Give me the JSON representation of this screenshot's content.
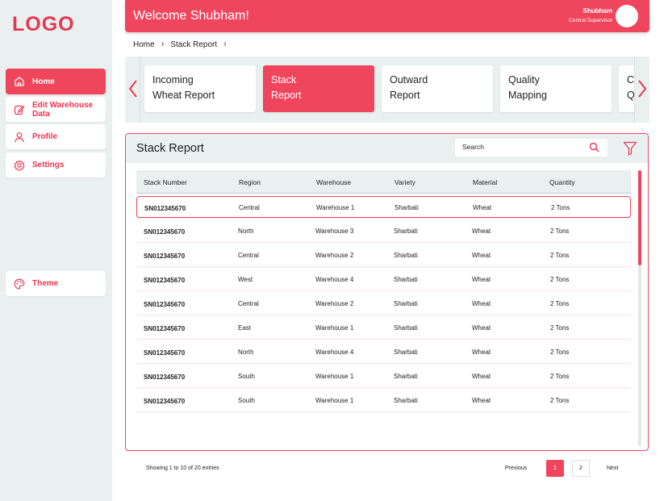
{
  "colors": {
    "accent": "#f0465d",
    "sidebar_bg": "#e9f0ef",
    "white": "#ffffff"
  },
  "logo": "LOGO",
  "sidebar": {
    "items": [
      {
        "label": "Home",
        "icon": "home-icon",
        "active": true
      },
      {
        "label": "Edit Warehouse Data",
        "icon": "edit-icon",
        "active": false
      },
      {
        "label": "Profile",
        "icon": "user-icon",
        "active": false
      },
      {
        "label": "Settings",
        "icon": "gear-icon",
        "active": false
      },
      {
        "label": "Theme",
        "icon": "palette-icon",
        "active": false
      }
    ]
  },
  "header": {
    "welcome": "Welcome Shubham!",
    "user_name": "Shubham",
    "user_role": "Central Supervisor"
  },
  "breadcrumb": {
    "items": [
      "Home",
      "Stack Report"
    ]
  },
  "cards": [
    {
      "line1": "Incoming",
      "line2": "Wheat Report",
      "active": false
    },
    {
      "line1": "Stack",
      "line2": "Report",
      "active": true
    },
    {
      "line1": "Outward",
      "line2": "Report",
      "active": false
    },
    {
      "line1": "Quality",
      "line2": "Mapping",
      "active": false
    },
    {
      "line1": "Cu",
      "line2": "Qu",
      "active": false
    }
  ],
  "panel": {
    "title": "Stack Report",
    "search_placeholder": "Search"
  },
  "table": {
    "columns": [
      "Stack Number",
      "Region",
      "Warehouse",
      "Variety",
      "Material",
      "Quantity"
    ],
    "rows": [
      [
        "SN012345670",
        "Central",
        "Warehouse 1",
        "Sharbati",
        "Wheat",
        "2 Tons"
      ],
      [
        "SN012345670",
        "North",
        "Warehouse 3",
        "Sharbati",
        "Wheat",
        "2 Tons"
      ],
      [
        "SN012345670",
        "Central",
        "Warehouse 2",
        "Sharbati",
        "Wheat",
        "2 Tons"
      ],
      [
        "SN012345670",
        "West",
        "Warehouse 4",
        "Sharbati",
        "Wheat",
        "2 Tons"
      ],
      [
        "SN012345670",
        "Central",
        "Warehouse 2",
        "Sharbati",
        "Wheat",
        "2 Tons"
      ],
      [
        "SN012345670",
        "East",
        "Warehouse 1",
        "Sharbati",
        "Wheat",
        "2 Tons"
      ],
      [
        "SN012345670",
        "North",
        "Warehouse 4",
        "Sharbati",
        "Wheat",
        "2 Tons"
      ],
      [
        "SN012345670",
        "South",
        "Warehouse 1",
        "Sharbati",
        "Wheat",
        "2 Tons"
      ],
      [
        "SN012345670",
        "South",
        "Warehouse 1",
        "Sharbati",
        "Wheat",
        "2 Tons"
      ]
    ]
  },
  "footer": {
    "showing": "Showing 1 to 10 of 20 entries",
    "prev": "Previous",
    "pages": [
      "1",
      "2"
    ],
    "current_page": "1",
    "next": "Next"
  }
}
